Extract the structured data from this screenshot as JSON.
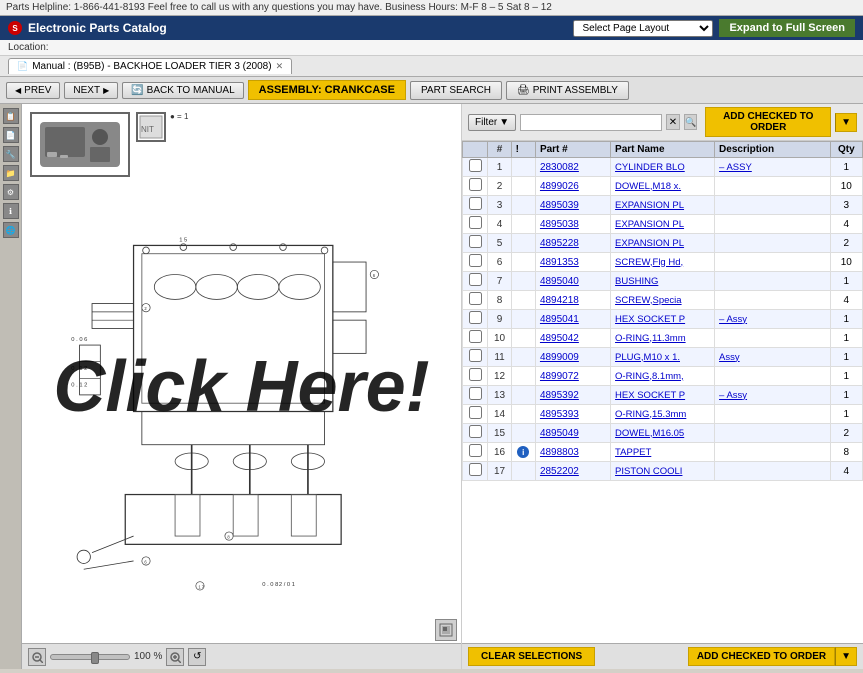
{
  "helpline": {
    "text": "Parts Helpline: 1-866-441-8193 Feel free to call us with any questions you may have. Business Hours: M-F 8 – 5 Sat 8 – 12"
  },
  "titlebar": {
    "logo": "S",
    "title": "Electronic Parts Catalog",
    "page_layout_placeholder": "Select Page Layout",
    "expand_btn": "Expand to Full Screen"
  },
  "location": {
    "label": "Location:"
  },
  "manual_tab": {
    "label": "Manual : (B95B) - BACKHOE LOADER TIER 3 (2008)"
  },
  "navbar": {
    "prev": "PREV",
    "next": "NEXT",
    "back_to_manual": "BACK TO MANUAL",
    "assembly_label": "ASSEMBLY: CRANKCASE",
    "part_search": "PART SEARCH",
    "print_assembly": "PRINT ASSEMBLY"
  },
  "filter": {
    "label": "Filter",
    "placeholder": "",
    "add_checked": "ADD CHECKED TO ORDER"
  },
  "table": {
    "headers": [
      "",
      "#",
      "!",
      "Part #",
      "Part Name",
      "Description",
      "Qty"
    ],
    "rows": [
      {
        "num": "1",
        "flag": "",
        "part_num": "2830082",
        "part_name": "CYLINDER BLO",
        "description": "– ASSY",
        "qty": "1"
      },
      {
        "num": "2",
        "flag": "",
        "part_num": "4899026",
        "part_name": "DOWEL,M18 x.",
        "description": "",
        "qty": "10"
      },
      {
        "num": "3",
        "flag": "",
        "part_num": "4895039",
        "part_name": "EXPANSION PL",
        "description": "",
        "qty": "3"
      },
      {
        "num": "4",
        "flag": "",
        "part_num": "4895038",
        "part_name": "EXPANSION PL",
        "description": "",
        "qty": "4"
      },
      {
        "num": "5",
        "flag": "",
        "part_num": "4895228",
        "part_name": "EXPANSION PL",
        "description": "",
        "qty": "2"
      },
      {
        "num": "6",
        "flag": "",
        "part_num": "4891353",
        "part_name": "SCREW,Flg Hd,",
        "description": "",
        "qty": "10"
      },
      {
        "num": "7",
        "flag": "",
        "part_num": "4895040",
        "part_name": "BUSHING",
        "description": "",
        "qty": "1"
      },
      {
        "num": "8",
        "flag": "",
        "part_num": "4894218",
        "part_name": "SCREW,Specia",
        "description": "",
        "qty": "4"
      },
      {
        "num": "9",
        "flag": "",
        "part_num": "4895041",
        "part_name": "HEX SOCKET P",
        "description": "– Assy",
        "qty": "1"
      },
      {
        "num": "10",
        "flag": "",
        "part_num": "4895042",
        "part_name": "O-RING,11.3mm",
        "description": "",
        "qty": "1"
      },
      {
        "num": "11",
        "flag": "",
        "part_num": "4899009",
        "part_name": "PLUG,M10 x 1.",
        "description": "Assy",
        "qty": "1"
      },
      {
        "num": "12",
        "flag": "",
        "part_num": "4899072",
        "part_name": "O-RING,8.1mm,",
        "description": "",
        "qty": "1"
      },
      {
        "num": "13",
        "flag": "",
        "part_num": "4895392",
        "part_name": "HEX SOCKET P",
        "description": "– Assy",
        "qty": "1"
      },
      {
        "num": "14",
        "flag": "",
        "part_num": "4895393",
        "part_name": "O-RING,15.3mm",
        "description": "",
        "qty": "1"
      },
      {
        "num": "15",
        "flag": "",
        "part_num": "4895049",
        "part_name": "DOWEL,M16.05",
        "description": "",
        "qty": "2"
      },
      {
        "num": "16",
        "flag": "!",
        "part_num": "4898803",
        "part_name": "TAPPET",
        "description": "",
        "qty": "8"
      },
      {
        "num": "17",
        "flag": "",
        "part_num": "2852202",
        "part_name": "PISTON COOLI",
        "description": "",
        "qty": "4"
      }
    ]
  },
  "bottom": {
    "clear_selections": "CLEAR SELECTIONS",
    "add_checked_order": "ADD CHECKED TO ORDER"
  },
  "zoom": {
    "percent": "100 %"
  },
  "click_here": "Click Here!"
}
